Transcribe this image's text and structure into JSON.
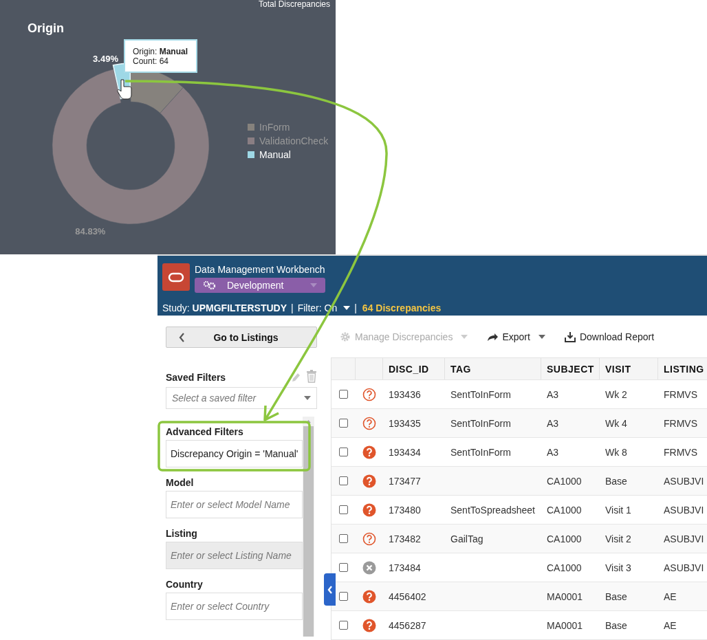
{
  "chart_panel": {
    "header_text": "Total Discrepancies",
    "title": "Origin",
    "chart_data": {
      "type": "donut",
      "categories": [
        "InForm",
        "ValidationCheck",
        "Manual"
      ],
      "values": [
        11.68,
        84.83,
        3.49
      ],
      "value_labels": [
        null,
        "84.83%",
        "3.49%"
      ],
      "legend": true
    },
    "slices": [
      {
        "color": "#86827d",
        "highlighted": false
      },
      {
        "color": "#8a7e83",
        "highlighted": false
      },
      {
        "color": "#9ed8e6",
        "highlighted": true
      }
    ],
    "tooltip": {
      "lines": [
        "Origin: **Manual**",
        "Count: 64"
      ]
    }
  },
  "app": {
    "title": "Data Management Workbench",
    "environment": "Development",
    "status_bar": [
      {
        "kind": "study",
        "text": "Study: **UPMGFILTERSTUDY**"
      },
      {
        "kind": "separator",
        "text": "|"
      },
      {
        "kind": "filter",
        "text": "Filter: On"
      },
      {
        "kind": "separator",
        "text": "|"
      },
      {
        "kind": "count",
        "text": "64 Discrepancies"
      }
    ]
  },
  "sidebar": {
    "back_button": "Go to Listings",
    "saved_filters": {
      "label": "Saved Filters",
      "placeholder": "Select a saved filter"
    },
    "filters": [
      {
        "label": "Advanced Filters",
        "value": "Discrepancy Origin = 'Manual'",
        "disabled": false
      },
      {
        "label": "Model",
        "placeholder": "Enter or select Model Name",
        "disabled": false
      },
      {
        "label": "Listing",
        "placeholder": "Enter or select Listing Name",
        "disabled": true
      },
      {
        "label": "Country",
        "placeholder": "Enter or select Country",
        "disabled": false
      }
    ]
  },
  "toolbar": [
    {
      "kind": "manage",
      "label": "Manage Discrepancies",
      "disabled": true,
      "dropdown": true
    },
    {
      "kind": "export",
      "label": "Export",
      "disabled": false,
      "dropdown": true
    },
    {
      "kind": "download",
      "label": "Download Report",
      "disabled": false,
      "dropdown": false
    }
  ],
  "table": {
    "columns": [
      "DISC_ID",
      "TAG",
      "SUBJECT",
      "VISIT",
      "LISTING"
    ],
    "rows": [
      {
        "checked": false,
        "kind": "question-outline",
        "disc_id": "193436",
        "tag": "SentToInForm",
        "subject": "A3",
        "visit": "Wk 2",
        "listing": "FRMVS"
      },
      {
        "checked": false,
        "kind": "question-outline",
        "disc_id": "193435",
        "tag": "SentToInForm",
        "subject": "A3",
        "visit": "Wk 4",
        "listing": "FRMVS"
      },
      {
        "checked": false,
        "kind": "question-filled",
        "disc_id": "193434",
        "tag": "SentToInForm",
        "subject": "A3",
        "visit": "Wk 8",
        "listing": "FRMVS"
      },
      {
        "checked": false,
        "kind": "question-filled",
        "disc_id": "173477",
        "subject": "CA1000",
        "visit": "Base",
        "listing": "ASUBJVI"
      },
      {
        "checked": false,
        "kind": "question-filled",
        "disc_id": "173480",
        "tag": "SentToSpreadsheet",
        "subject": "CA1000",
        "visit": "Visit 1",
        "listing": "ASUBJVI"
      },
      {
        "checked": false,
        "kind": "question-outline",
        "disc_id": "173482",
        "tag": "GailTag",
        "subject": "CA1000",
        "visit": "Visit 2",
        "listing": "ASUBJVI"
      },
      {
        "checked": false,
        "kind": "cancelled",
        "disc_id": "173484",
        "subject": "CA1000",
        "visit": "Visit 3",
        "listing": "ASUBJVI"
      },
      {
        "checked": false,
        "kind": "question-filled",
        "disc_id": "4456402",
        "subject": "MA0001",
        "visit": "Base",
        "listing": "AE"
      },
      {
        "checked": false,
        "kind": "question-filled",
        "disc_id": "4456287",
        "subject": "MA0001",
        "visit": "Base",
        "listing": "AE"
      }
    ]
  }
}
